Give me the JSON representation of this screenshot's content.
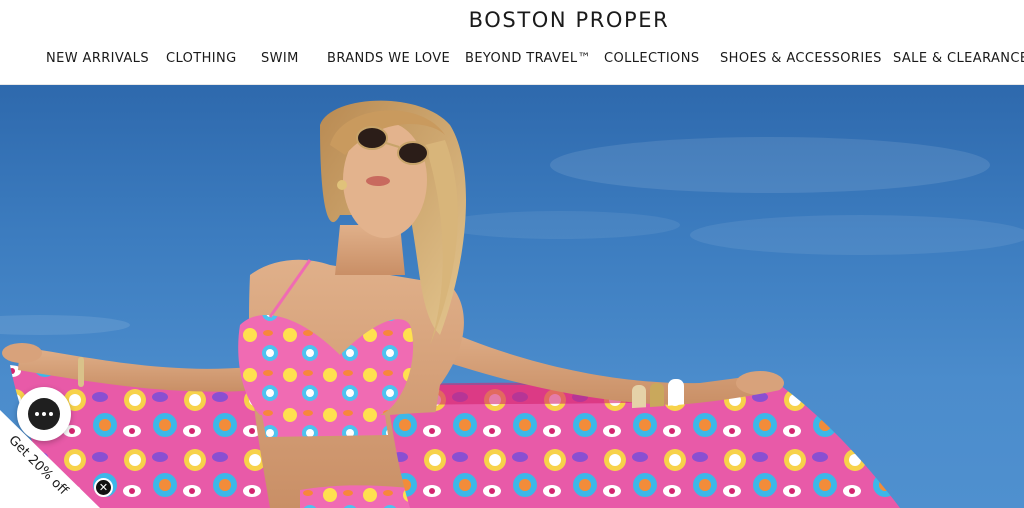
{
  "header": {
    "logo": "BOSTON PROPER"
  },
  "nav": {
    "items": [
      "NEW ARRIVALS",
      "CLOTHING",
      "SWIM",
      "BRANDS WE LOVE",
      "BEYOND TRAVEL™",
      "COLLECTIONS",
      "SHOES & ACCESSORIES",
      "SALE & CLEARANCE"
    ]
  },
  "promo": {
    "label": "Get 20% off",
    "close_glyph": "✕"
  },
  "colors": {
    "sky": "#3c7cbf",
    "text": "#1a1a1a",
    "chat": "#1f1f1f"
  },
  "icons": {
    "chat": "chat-bubble-icon",
    "close": "close-icon"
  }
}
